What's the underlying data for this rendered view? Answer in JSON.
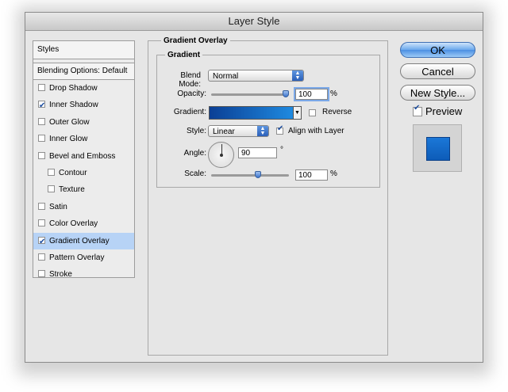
{
  "window": {
    "title": "Layer Style"
  },
  "styles_panel": {
    "header": "Styles",
    "blending_options": "Blending Options: Default",
    "items": [
      {
        "label": "Drop Shadow",
        "checked": false,
        "indent": false,
        "selected": false
      },
      {
        "label": "Inner Shadow",
        "checked": true,
        "indent": false,
        "selected": false
      },
      {
        "label": "Outer Glow",
        "checked": false,
        "indent": false,
        "selected": false
      },
      {
        "label": "Inner Glow",
        "checked": false,
        "indent": false,
        "selected": false
      },
      {
        "label": "Bevel and Emboss",
        "checked": false,
        "indent": false,
        "selected": false
      },
      {
        "label": "Contour",
        "checked": false,
        "indent": true,
        "selected": false
      },
      {
        "label": "Texture",
        "checked": false,
        "indent": true,
        "selected": false
      },
      {
        "label": "Satin",
        "checked": false,
        "indent": false,
        "selected": false
      },
      {
        "label": "Color Overlay",
        "checked": false,
        "indent": false,
        "selected": false
      },
      {
        "label": "Gradient Overlay",
        "checked": true,
        "indent": false,
        "selected": true
      },
      {
        "label": "Pattern Overlay",
        "checked": false,
        "indent": false,
        "selected": false
      },
      {
        "label": "Stroke",
        "checked": false,
        "indent": false,
        "selected": false
      }
    ]
  },
  "gradient_overlay": {
    "section_title": "Gradient Overlay",
    "group_title": "Gradient",
    "blend_mode_label": "Blend Mode:",
    "blend_mode_value": "Normal",
    "opacity_label": "Opacity:",
    "opacity_value": "100",
    "opacity_unit": "%",
    "opacity_level": 1.0,
    "gradient_label": "Gradient:",
    "gradient_colors": [
      "#0b3f95",
      "#1f8ae0"
    ],
    "reverse_label": "Reverse",
    "reverse_checked": false,
    "style_label": "Style:",
    "style_value": "Linear",
    "align_label": "Align with Layer",
    "align_checked": true,
    "angle_label": "Angle:",
    "angle_value": "90",
    "angle_unit": "°",
    "scale_label": "Scale:",
    "scale_value": "100",
    "scale_unit": "%",
    "scale_level": 0.6
  },
  "buttons": {
    "ok": "OK",
    "cancel": "Cancel",
    "new_style": "New Style...",
    "preview_label": "Preview",
    "preview_checked": true
  },
  "colors": {
    "selection": "#b7d3f6",
    "accent": "#4b8fe2",
    "preview_fill": "#1b78d8"
  }
}
